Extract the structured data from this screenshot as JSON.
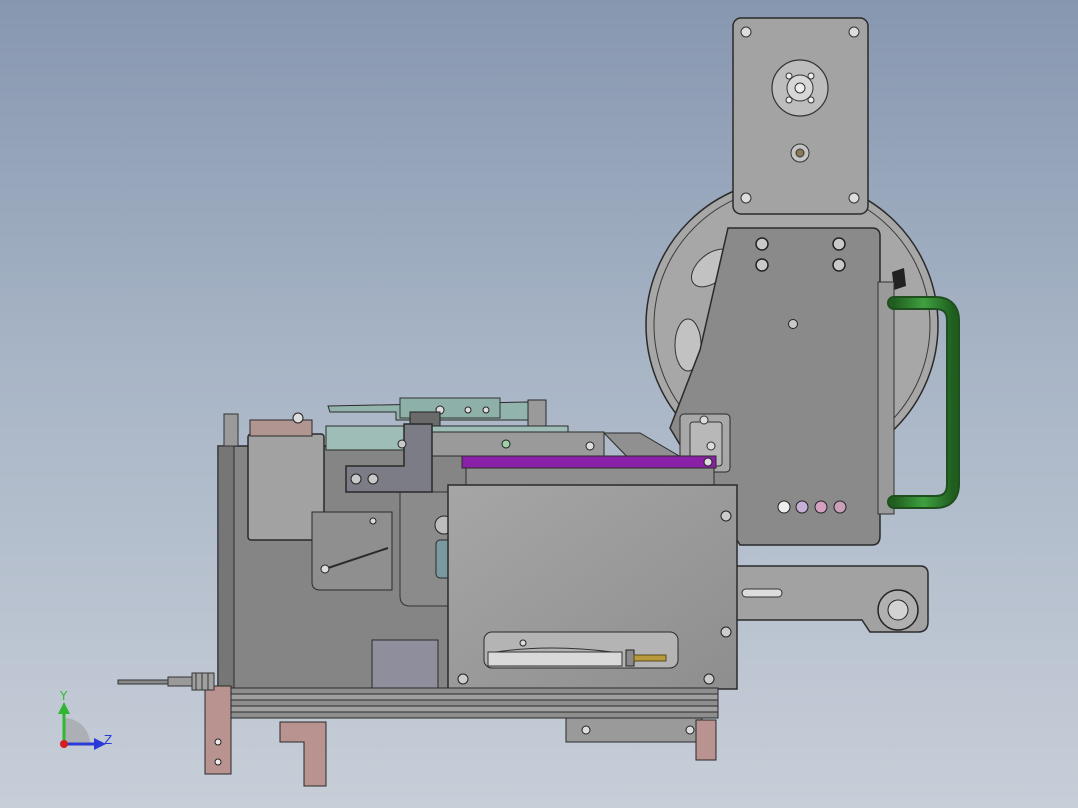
{
  "viewport": {
    "background_top": "#8797b0",
    "background_bottom": "#c7ced8"
  },
  "model": {
    "part_colors": {
      "body": "#8c8c8c",
      "panel": "#9e9e9e",
      "outline": "#2a2a2a",
      "bracket": "#b08f8c",
      "teal_plate": "#8fb3ad",
      "purple_bar": "#8a1fa8",
      "green_hose": "#2f7d2f",
      "reel": "#a9a9a9",
      "brass": "#b89a3a"
    }
  },
  "triad": {
    "y_label": "Y",
    "z_label": "Z",
    "y_color": "#2fb82f",
    "z_color": "#2b39d6",
    "x_color": "#d22020"
  }
}
